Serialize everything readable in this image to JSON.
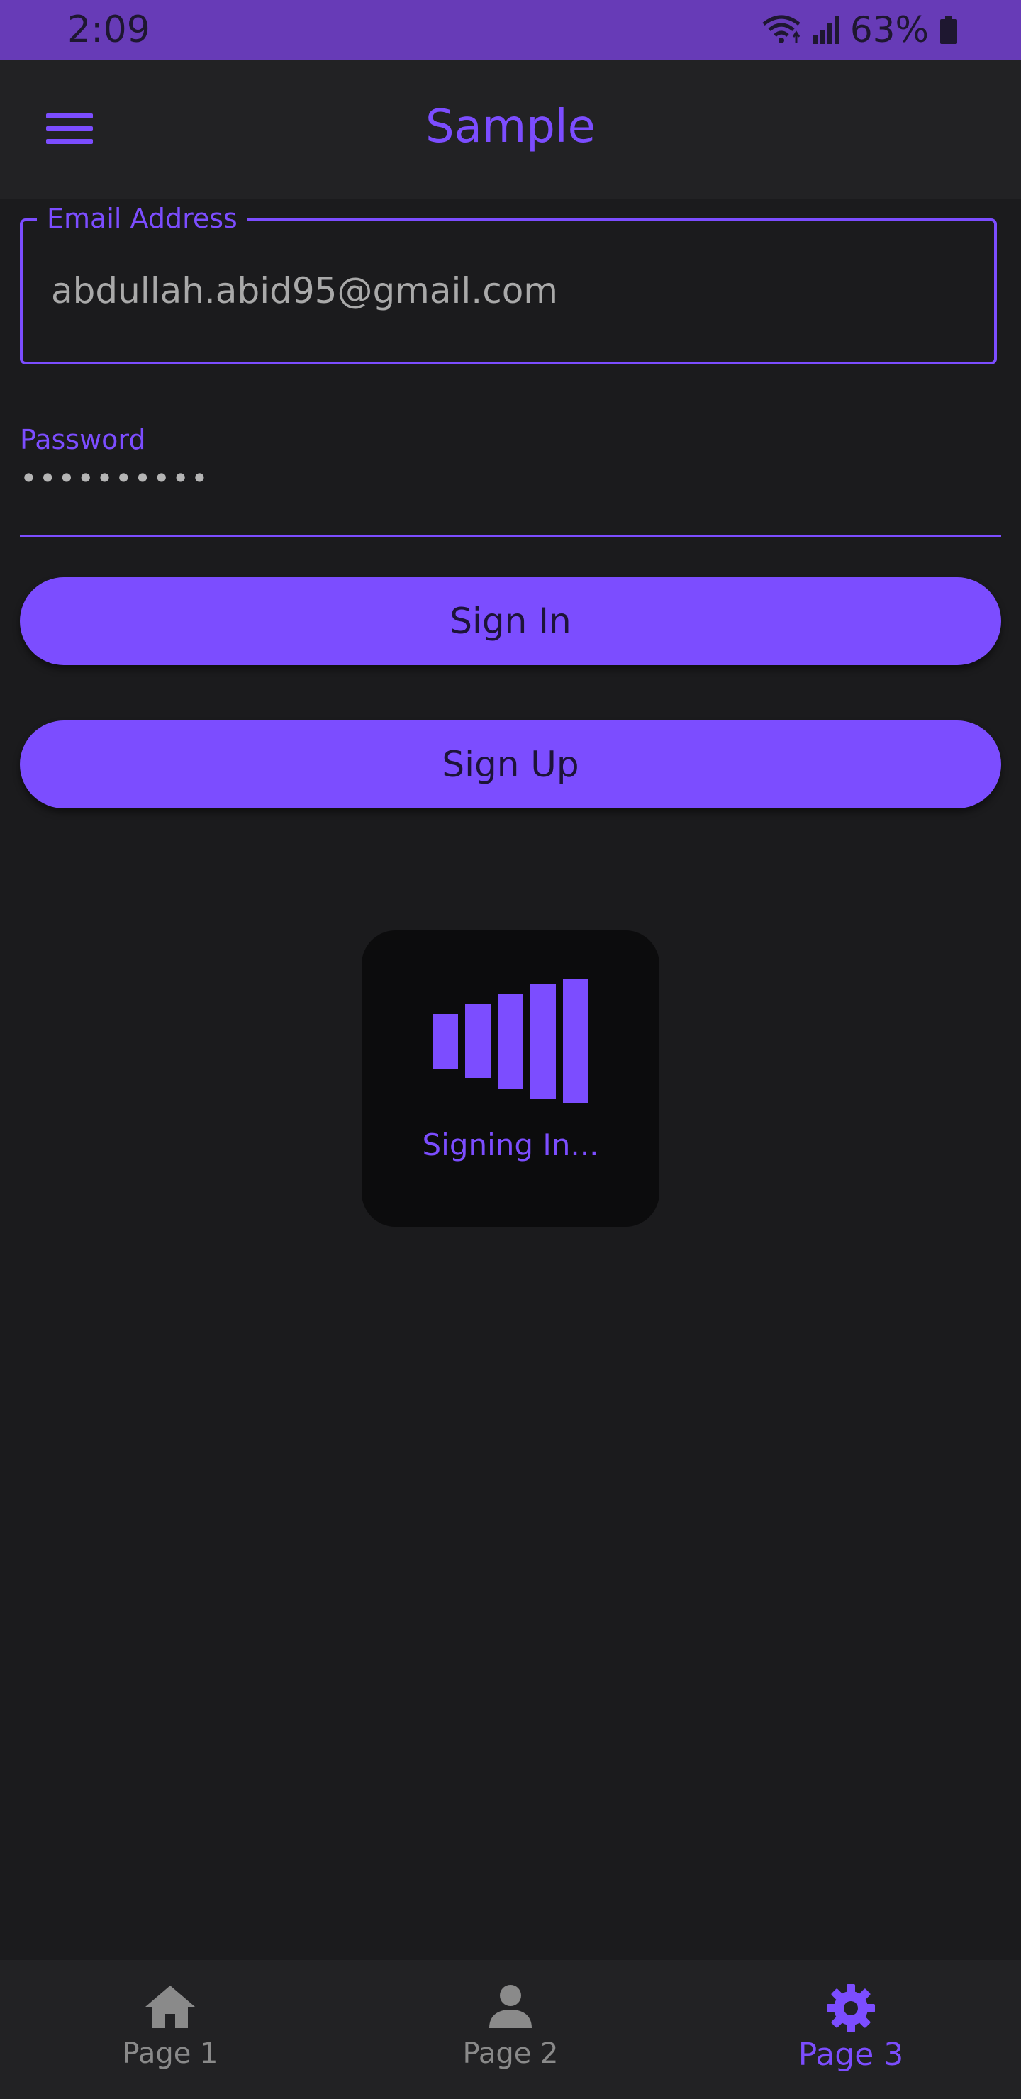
{
  "status_bar": {
    "time": "2:09",
    "battery": "63%",
    "icons": [
      "wifi-icon",
      "signal-icon",
      "battery-icon"
    ]
  },
  "app_bar": {
    "title": "Sample",
    "menu_icon": "menu-icon"
  },
  "form": {
    "email_label": "Email Address",
    "email_value": "abdullah.abid95@gmail.com",
    "password_label": "Password",
    "password_value": "••••••••••",
    "sign_in_label": "Sign In",
    "sign_up_label": "Sign Up"
  },
  "loader": {
    "caption": "Signing In..."
  },
  "bottom_nav": {
    "items": [
      {
        "label": "Page 1",
        "icon": "home-icon",
        "active": false
      },
      {
        "label": "Page 2",
        "icon": "person-icon",
        "active": false
      },
      {
        "label": "Page 3",
        "icon": "gear-icon",
        "active": true
      }
    ]
  },
  "colors": {
    "accent": "#7c4dff",
    "status_bar": "#673bb7",
    "background": "#1b1b1d",
    "surface": "#222224"
  }
}
